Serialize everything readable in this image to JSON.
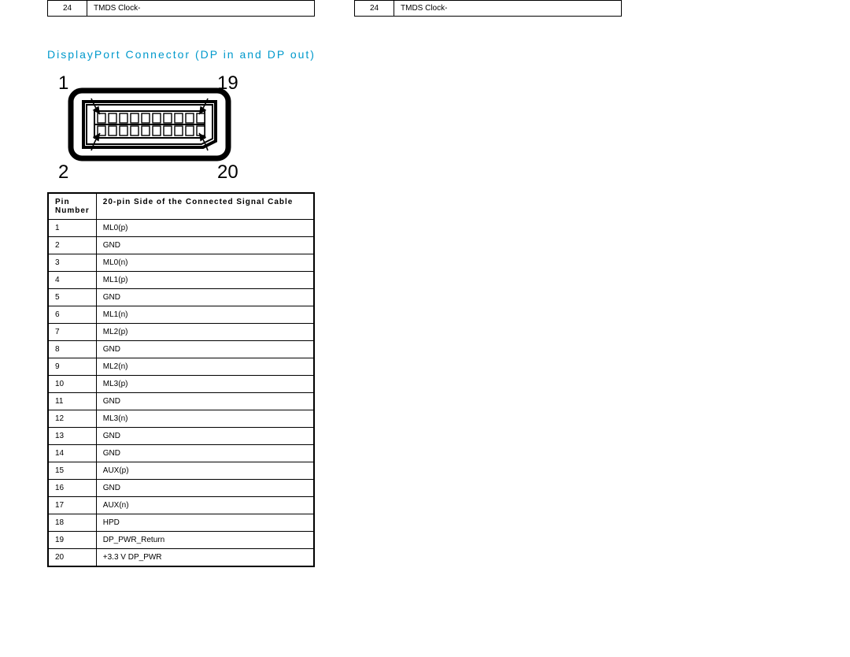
{
  "topTables": [
    {
      "pin": "24",
      "signal": "TMDS Clock-"
    },
    {
      "pin": "24",
      "signal": "TMDS Clock-"
    }
  ],
  "heading": "DisplayPort Connector (DP in and DP out)",
  "connector": {
    "labels": {
      "tl": "1",
      "tr": "19",
      "bl": "2",
      "br": "20"
    }
  },
  "pinTable": {
    "header": {
      "col1": "Pin Number",
      "col2": "20-pin Side of the Connected Signal Cable"
    },
    "rows": [
      {
        "pin": "1",
        "signal": "ML0(p)"
      },
      {
        "pin": "2",
        "signal": "GND"
      },
      {
        "pin": "3",
        "signal": "ML0(n)"
      },
      {
        "pin": "4",
        "signal": "ML1(p)"
      },
      {
        "pin": "5",
        "signal": "GND"
      },
      {
        "pin": "6",
        "signal": "ML1(n)"
      },
      {
        "pin": "7",
        "signal": "ML2(p)"
      },
      {
        "pin": "8",
        "signal": "GND"
      },
      {
        "pin": "9",
        "signal": "ML2(n)"
      },
      {
        "pin": "10",
        "signal": "ML3(p)"
      },
      {
        "pin": "11",
        "signal": "GND"
      },
      {
        "pin": "12",
        "signal": "ML3(n)"
      },
      {
        "pin": "13",
        "signal": "GND"
      },
      {
        "pin": "14",
        "signal": "GND"
      },
      {
        "pin": "15",
        "signal": "AUX(p)"
      },
      {
        "pin": "16",
        "signal": "GND"
      },
      {
        "pin": "17",
        "signal": "AUX(n)"
      },
      {
        "pin": "18",
        "signal": "HPD"
      },
      {
        "pin": "19",
        "signal": "DP_PWR_Return"
      },
      {
        "pin": "20",
        "signal": "+3.3 V DP_PWR"
      }
    ]
  }
}
